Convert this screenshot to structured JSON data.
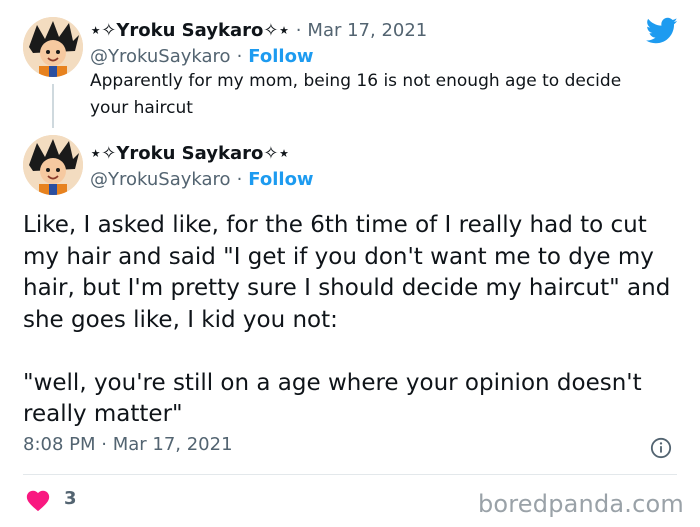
{
  "reply_tweet": {
    "display_name": "⋆✧Yroku Saykaro✧⋆",
    "separator": "·",
    "date": "Mar 17, 2021",
    "handle": "@YrokuSaykaro",
    "handle_dot": "·",
    "follow_label": "Follow",
    "text": "Apparently for my mom, being 16 is not enough age to decide your haircut"
  },
  "main_tweet": {
    "display_name": "⋆✧Yroku Saykaro✧⋆",
    "handle": "@YrokuSaykaro",
    "handle_dot": "·",
    "follow_label": "Follow",
    "paragraph_1": "Like, I asked like, for the 6th time of I really had to cut my hair and said \"I get if you don't want me to dye my hair, but I'm pretty sure I should decide my haircut\" and she goes like, I kid you not:",
    "paragraph_2": "\"well, you're still on a age where your opinion doesn't really matter\"",
    "timestamp": "8:08 PM · Mar 17, 2021",
    "like_count": "3"
  },
  "icons": {
    "brand": "twitter-bird-icon",
    "info": "info-icon",
    "like": "heart-icon",
    "avatar": "avatar-image"
  },
  "colors": {
    "link_blue": "#1d9bf0",
    "heart_red": "#f91880",
    "muted_text": "#536471"
  },
  "watermark": "boredpanda.com"
}
